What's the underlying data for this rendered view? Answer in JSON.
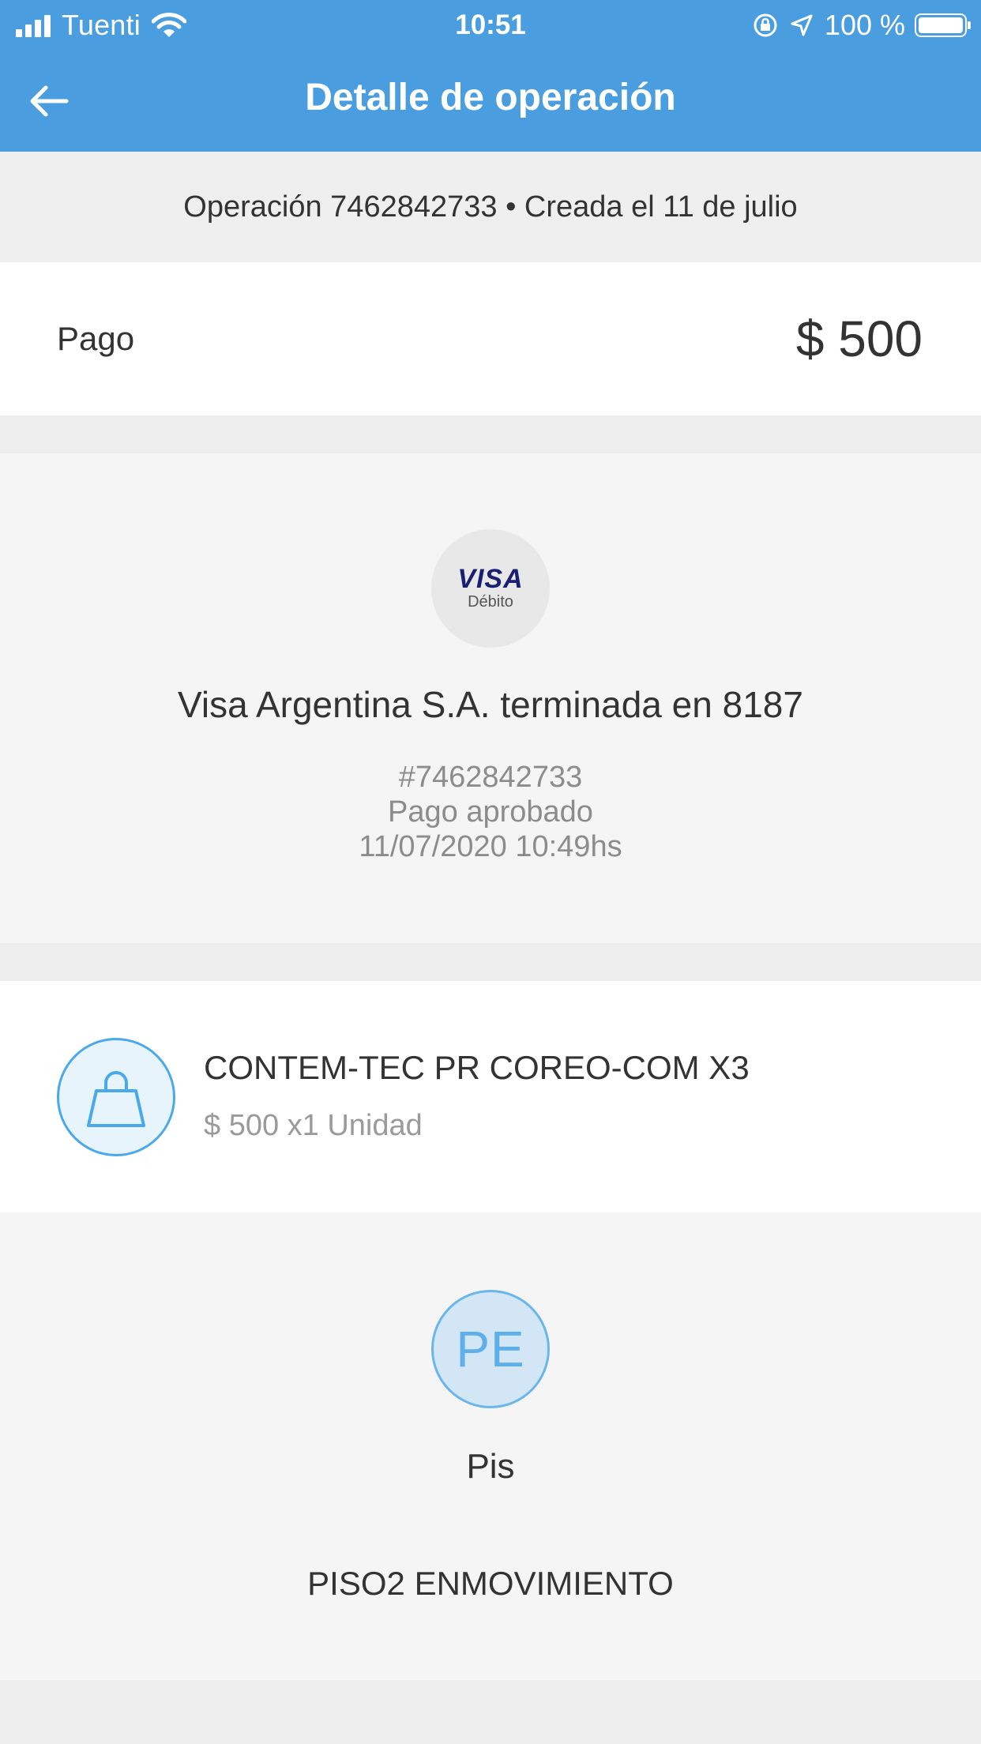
{
  "status_bar": {
    "carrier": "Tuenti",
    "time": "10:51",
    "battery_percent": "100 %",
    "signal_icon": "cellular-signal-icon",
    "wifi_icon": "wifi-icon",
    "rotation_lock_icon": "rotation-lock-icon",
    "location_icon": "location-arrow-icon",
    "battery_icon": "battery-icon",
    "battery_level": 1.0
  },
  "nav": {
    "title": "Detalle de operación",
    "back_icon": "arrow-left-icon"
  },
  "operation": {
    "summary": "Operación 7462842733 • Creada el 11 de julio"
  },
  "payment": {
    "label": "Pago",
    "amount": "$ 500"
  },
  "card": {
    "brand": "VISA",
    "type": "Débito",
    "name": "Visa Argentina S.A. terminada en 8187",
    "operation_ref": "#7462842733",
    "status": "Pago aprobado",
    "datetime": "11/07/2020 10:49hs"
  },
  "product": {
    "icon": "shopping-bag-icon",
    "name": "CONTEM-TEC PR COREO-COM X3",
    "price_qty": "$ 500 x1 Unidad"
  },
  "seller": {
    "initials": "PE",
    "name": "Pis",
    "address": "PISO2 ENMOVIMIENTO"
  },
  "colors": {
    "header": "#4a9ee0",
    "accent": "#4aa9eb",
    "background": "#ededed"
  }
}
